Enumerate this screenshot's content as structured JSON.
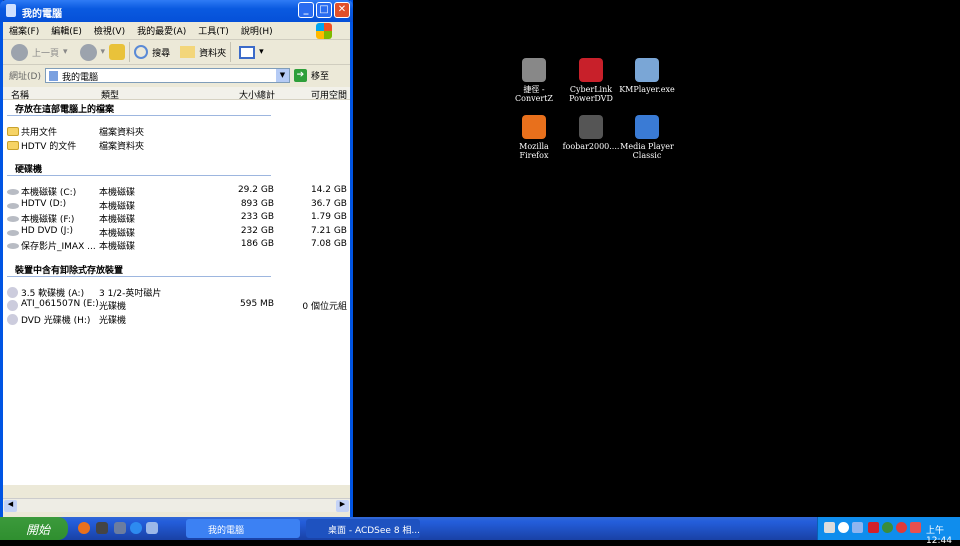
{
  "window": {
    "title": "我的電腦",
    "minimize": "_",
    "maximize": "□",
    "close": "✕"
  },
  "menu": [
    "檔案(F)",
    "編輯(E)",
    "檢視(V)",
    "我的最愛(A)",
    "工具(T)",
    "說明(H)"
  ],
  "toolbar": {
    "back": "上一頁",
    "search": "搜尋",
    "folders": "資料夾"
  },
  "address": {
    "label": "網址(D)",
    "value": "我的電腦",
    "go": "移至"
  },
  "columns": [
    "名稱",
    "類型",
    "大小總計",
    "可用空間"
  ],
  "groups": [
    {
      "title": "存放在這部電腦上的檔案",
      "items": [
        {
          "name": "共用文件",
          "type": "檔案資料夾",
          "total": "",
          "free": "",
          "icon": "folder-icon"
        },
        {
          "name": "HDTV 的文件",
          "type": "檔案資料夾",
          "total": "",
          "free": "",
          "icon": "folder-icon"
        }
      ]
    },
    {
      "title": "硬碟機",
      "items": [
        {
          "name": "本機磁碟 (C:)",
          "type": "本機磁碟",
          "total": "29.2 GB",
          "free": "14.2 GB",
          "icon": "hard-drive-icon"
        },
        {
          "name": "HDTV (D:)",
          "type": "本機磁碟",
          "total": "893 GB",
          "free": "36.7 GB",
          "icon": "hard-drive-icon"
        },
        {
          "name": "本機磁碟 (F:)",
          "type": "本機磁碟",
          "total": "233 GB",
          "free": "1.79 GB",
          "icon": "hard-drive-icon"
        },
        {
          "name": "HD DVD (J:)",
          "type": "本機磁碟",
          "total": "232 GB",
          "free": "7.21 GB",
          "icon": "hard-drive-icon"
        },
        {
          "name": "保存影片_IMAX ...",
          "type": "本機磁碟",
          "total": "186 GB",
          "free": "7.08 GB",
          "icon": "hard-drive-icon"
        }
      ]
    },
    {
      "title": "裝置中含有卸除式存放裝置",
      "items": [
        {
          "name": "3.5 軟碟機 (A:)",
          "type": "3 1/2-英吋磁片",
          "total": "",
          "free": "",
          "icon": "floppy-drive-icon"
        },
        {
          "name": "ATI_061507N (E:)",
          "type": "光碟機",
          "total": "595 MB",
          "free": "0 個位元組",
          "icon": "cd-drive-icon"
        },
        {
          "name": "DVD 光碟機 (H:)",
          "type": "光碟機",
          "total": "",
          "free": "",
          "icon": "cd-drive-icon"
        }
      ]
    }
  ],
  "desktop": [
    {
      "label": "捷徑 - ConvertZ",
      "color": "#888888"
    },
    {
      "label": "CyberLink PowerDVD",
      "color": "#c8202a"
    },
    {
      "label": "KMPlayer.exe",
      "color": "#7aa6d6"
    },
    {
      "label": "Mozilla Firefox",
      "color": "#e8701c"
    },
    {
      "label": "foobar2000....",
      "color": "#555555"
    },
    {
      "label": "Media Player Classic",
      "color": "#3a7bd5"
    }
  ],
  "taskbar": {
    "start": "開始",
    "tasks": [
      "我的電腦",
      "桌面 - ACDSee 8 相..."
    ],
    "clock": "上午 12:44"
  }
}
